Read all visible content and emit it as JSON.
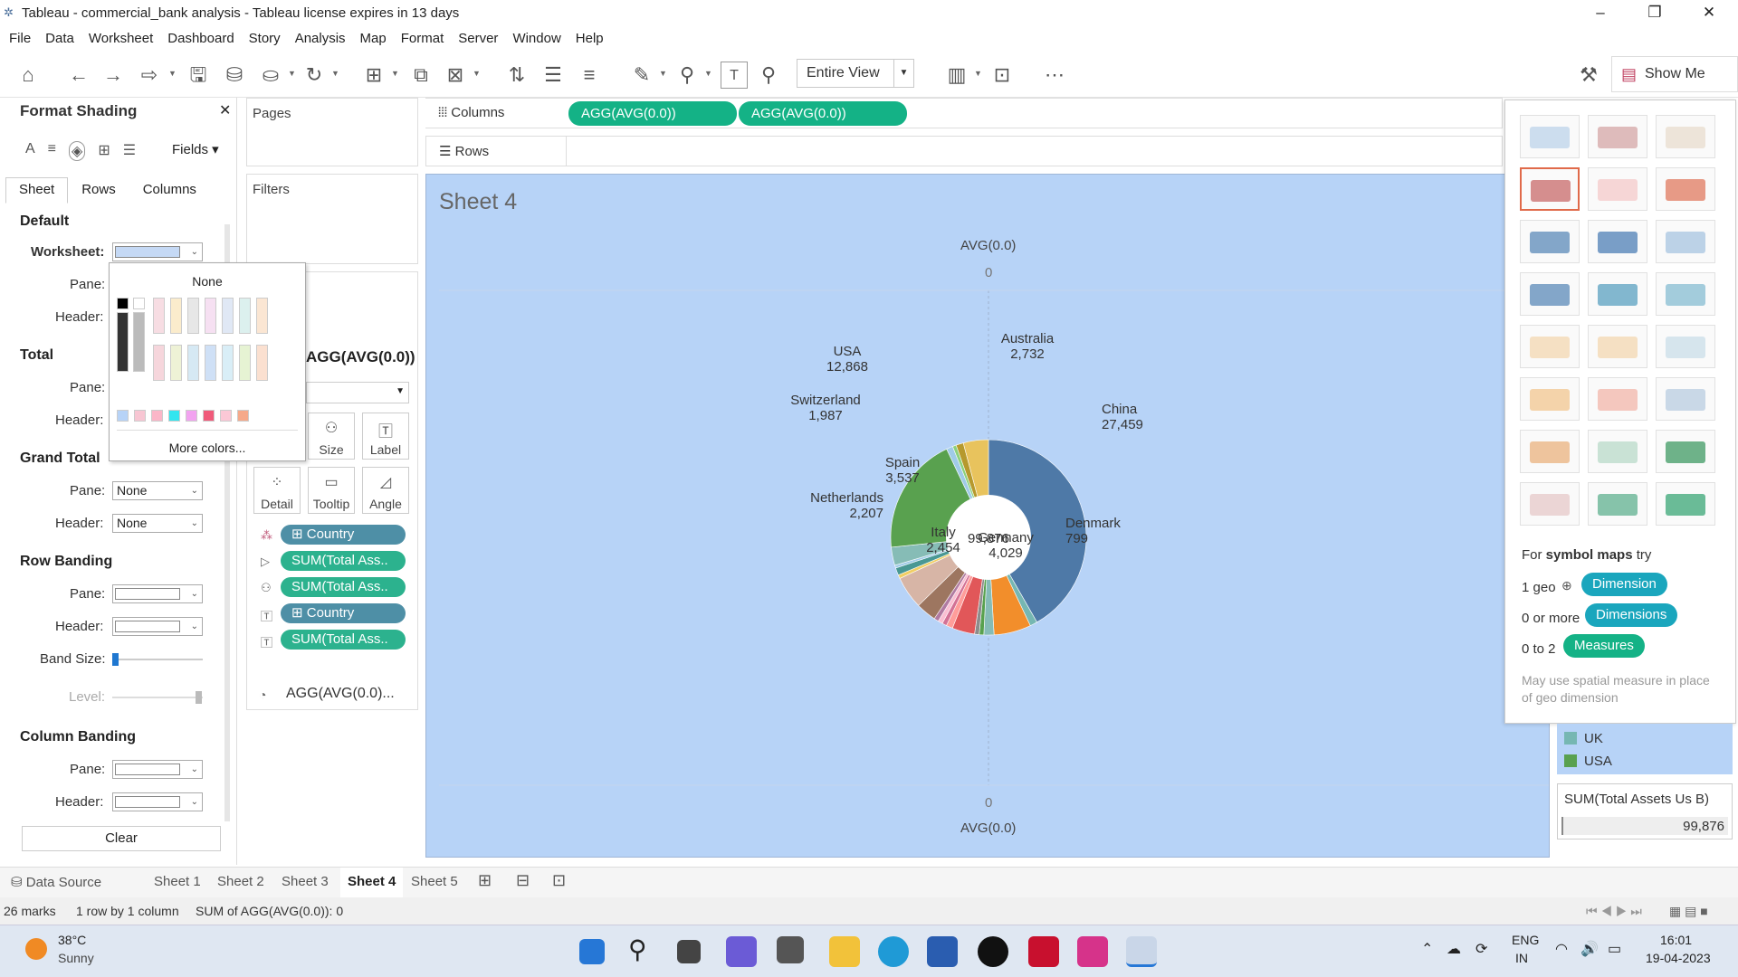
{
  "window": {
    "title": "Tableau - commercial_bank analysis - Tableau license expires in 13 days"
  },
  "menu": [
    "File",
    "Data",
    "Worksheet",
    "Dashboard",
    "Story",
    "Analysis",
    "Map",
    "Format",
    "Server",
    "Window",
    "Help"
  ],
  "toolbar": {
    "fit": "Entire View",
    "show_me": "Show Me"
  },
  "format_panel": {
    "title": "Format Shading",
    "fields_label": "Fields",
    "tabs": [
      "Sheet",
      "Rows",
      "Columns"
    ],
    "sections": {
      "default": "Default",
      "total": "Total",
      "grand_total": "Grand Total",
      "row_banding": "Row Banding",
      "column_banding": "Column Banding"
    },
    "labels": {
      "worksheet": "Worksheet:",
      "pane": "Pane:",
      "header": "Header:",
      "band_size": "Band Size:",
      "level": "Level:"
    },
    "none_value": "None",
    "clear": "Clear",
    "worksheet_color": "#c5d9f5"
  },
  "color_popup": {
    "none": "None",
    "more": "More colors..."
  },
  "cards": {
    "pages": "Pages",
    "filters": "Filters"
  },
  "marks": {
    "mark_type": "AGG(AVG(0.0))",
    "buttons": [
      "Size",
      "Label",
      "Detail",
      "Tooltip",
      "Angle"
    ],
    "pills": [
      "Country",
      "SUM(Total Ass..",
      "SUM(Total Ass..",
      "Country",
      "SUM(Total Ass.."
    ],
    "angle_field": "AGG(AVG(0.0)..."
  },
  "shelves": {
    "columns": "Columns",
    "rows": "Rows",
    "column_pills": [
      "AGG(AVG(0.0))",
      "AGG(AVG(0.0))"
    ]
  },
  "view": {
    "sheet_title": "Sheet 4",
    "axis_top_title": "AVG(0.0)",
    "axis_top_tick": "0",
    "axis_bottom_title": "AVG(0.0)",
    "axis_bottom_tick": "0",
    "center_label": "99,876"
  },
  "chart_data": {
    "type": "pie",
    "labels": [
      {
        "name": "China",
        "value": "27,459"
      },
      {
        "name": "Denmark",
        "value": "799"
      },
      {
        "name": "Germany",
        "value": "4,029"
      },
      {
        "name": "Italy",
        "value": "2,454"
      },
      {
        "name": "Netherlands",
        "value": "2,207"
      },
      {
        "name": "Spain",
        "value": "3,537"
      },
      {
        "name": "Switzerland",
        "value": "1,987"
      },
      {
        "name": "USA",
        "value": "12,868"
      },
      {
        "name": "Australia",
        "value": "2,732"
      }
    ],
    "total": 99876,
    "slices": [
      {
        "color": "#4e79a7",
        "value": 27459
      },
      {
        "color": "#76b7b2",
        "value": 799
      },
      {
        "color": "#f28e2b",
        "value": 4029
      },
      {
        "color": "#86bcb6",
        "value": 1100
      },
      {
        "color": "#59a14f",
        "value": 500
      },
      {
        "color": "#8c8c8c",
        "value": 500
      },
      {
        "color": "#e15759",
        "value": 2454
      },
      {
        "color": "#ff9d9a",
        "value": 700
      },
      {
        "color": "#d37295",
        "value": 500
      },
      {
        "color": "#fabfd2",
        "value": 500
      },
      {
        "color": "#b07aa1",
        "value": 500
      },
      {
        "color": "#9d7660",
        "value": 2207
      },
      {
        "color": "#d7b5a6",
        "value": 3537
      },
      {
        "color": "#f1ce63",
        "value": 400
      },
      {
        "color": "#499894",
        "value": 800
      },
      {
        "color": "#a0cbe8",
        "value": 300
      },
      {
        "color": "#86bcb6",
        "value": 1987
      },
      {
        "color": "#59a14f",
        "value": 12868
      },
      {
        "color": "#a0cbe8",
        "value": 700
      },
      {
        "color": "#8cd17d",
        "value": 400
      },
      {
        "color": "#b6992d",
        "value": 800
      },
      {
        "color": "#e8c35d",
        "value": 2732
      }
    ]
  },
  "show_me": {
    "hint_prefix": "For ",
    "hint_bold": "symbol maps",
    "hint_suffix": " try",
    "rows": [
      {
        "label": "1 geo",
        "pill": "Dimension"
      },
      {
        "label": "0 or more",
        "pill": "Dimensions"
      },
      {
        "label": "0 to 2",
        "pill": "Measures"
      }
    ],
    "note": "May use spatial measure in place of geo dimension"
  },
  "legend": {
    "items": [
      {
        "name": "UK",
        "color": "#76b7b2"
      },
      {
        "name": "USA",
        "color": "#59a14f"
      }
    ]
  },
  "size_legend": {
    "title": "SUM(Total Assets Us B)",
    "value": "99,876"
  },
  "sheet_tabs": [
    "Data Source",
    "Sheet 1",
    "Sheet 2",
    "Sheet 3",
    "Sheet 4",
    "Sheet 5"
  ],
  "status": {
    "marks": "26 marks",
    "dims": "1 row by 1 column",
    "sum": "SUM of AGG(AVG(0.0)): 0"
  },
  "taskbar": {
    "temp": "38°C",
    "weather": "Sunny",
    "lang1": "ENG",
    "lang2": "IN",
    "time": "16:01",
    "date": "19-04-2023"
  }
}
